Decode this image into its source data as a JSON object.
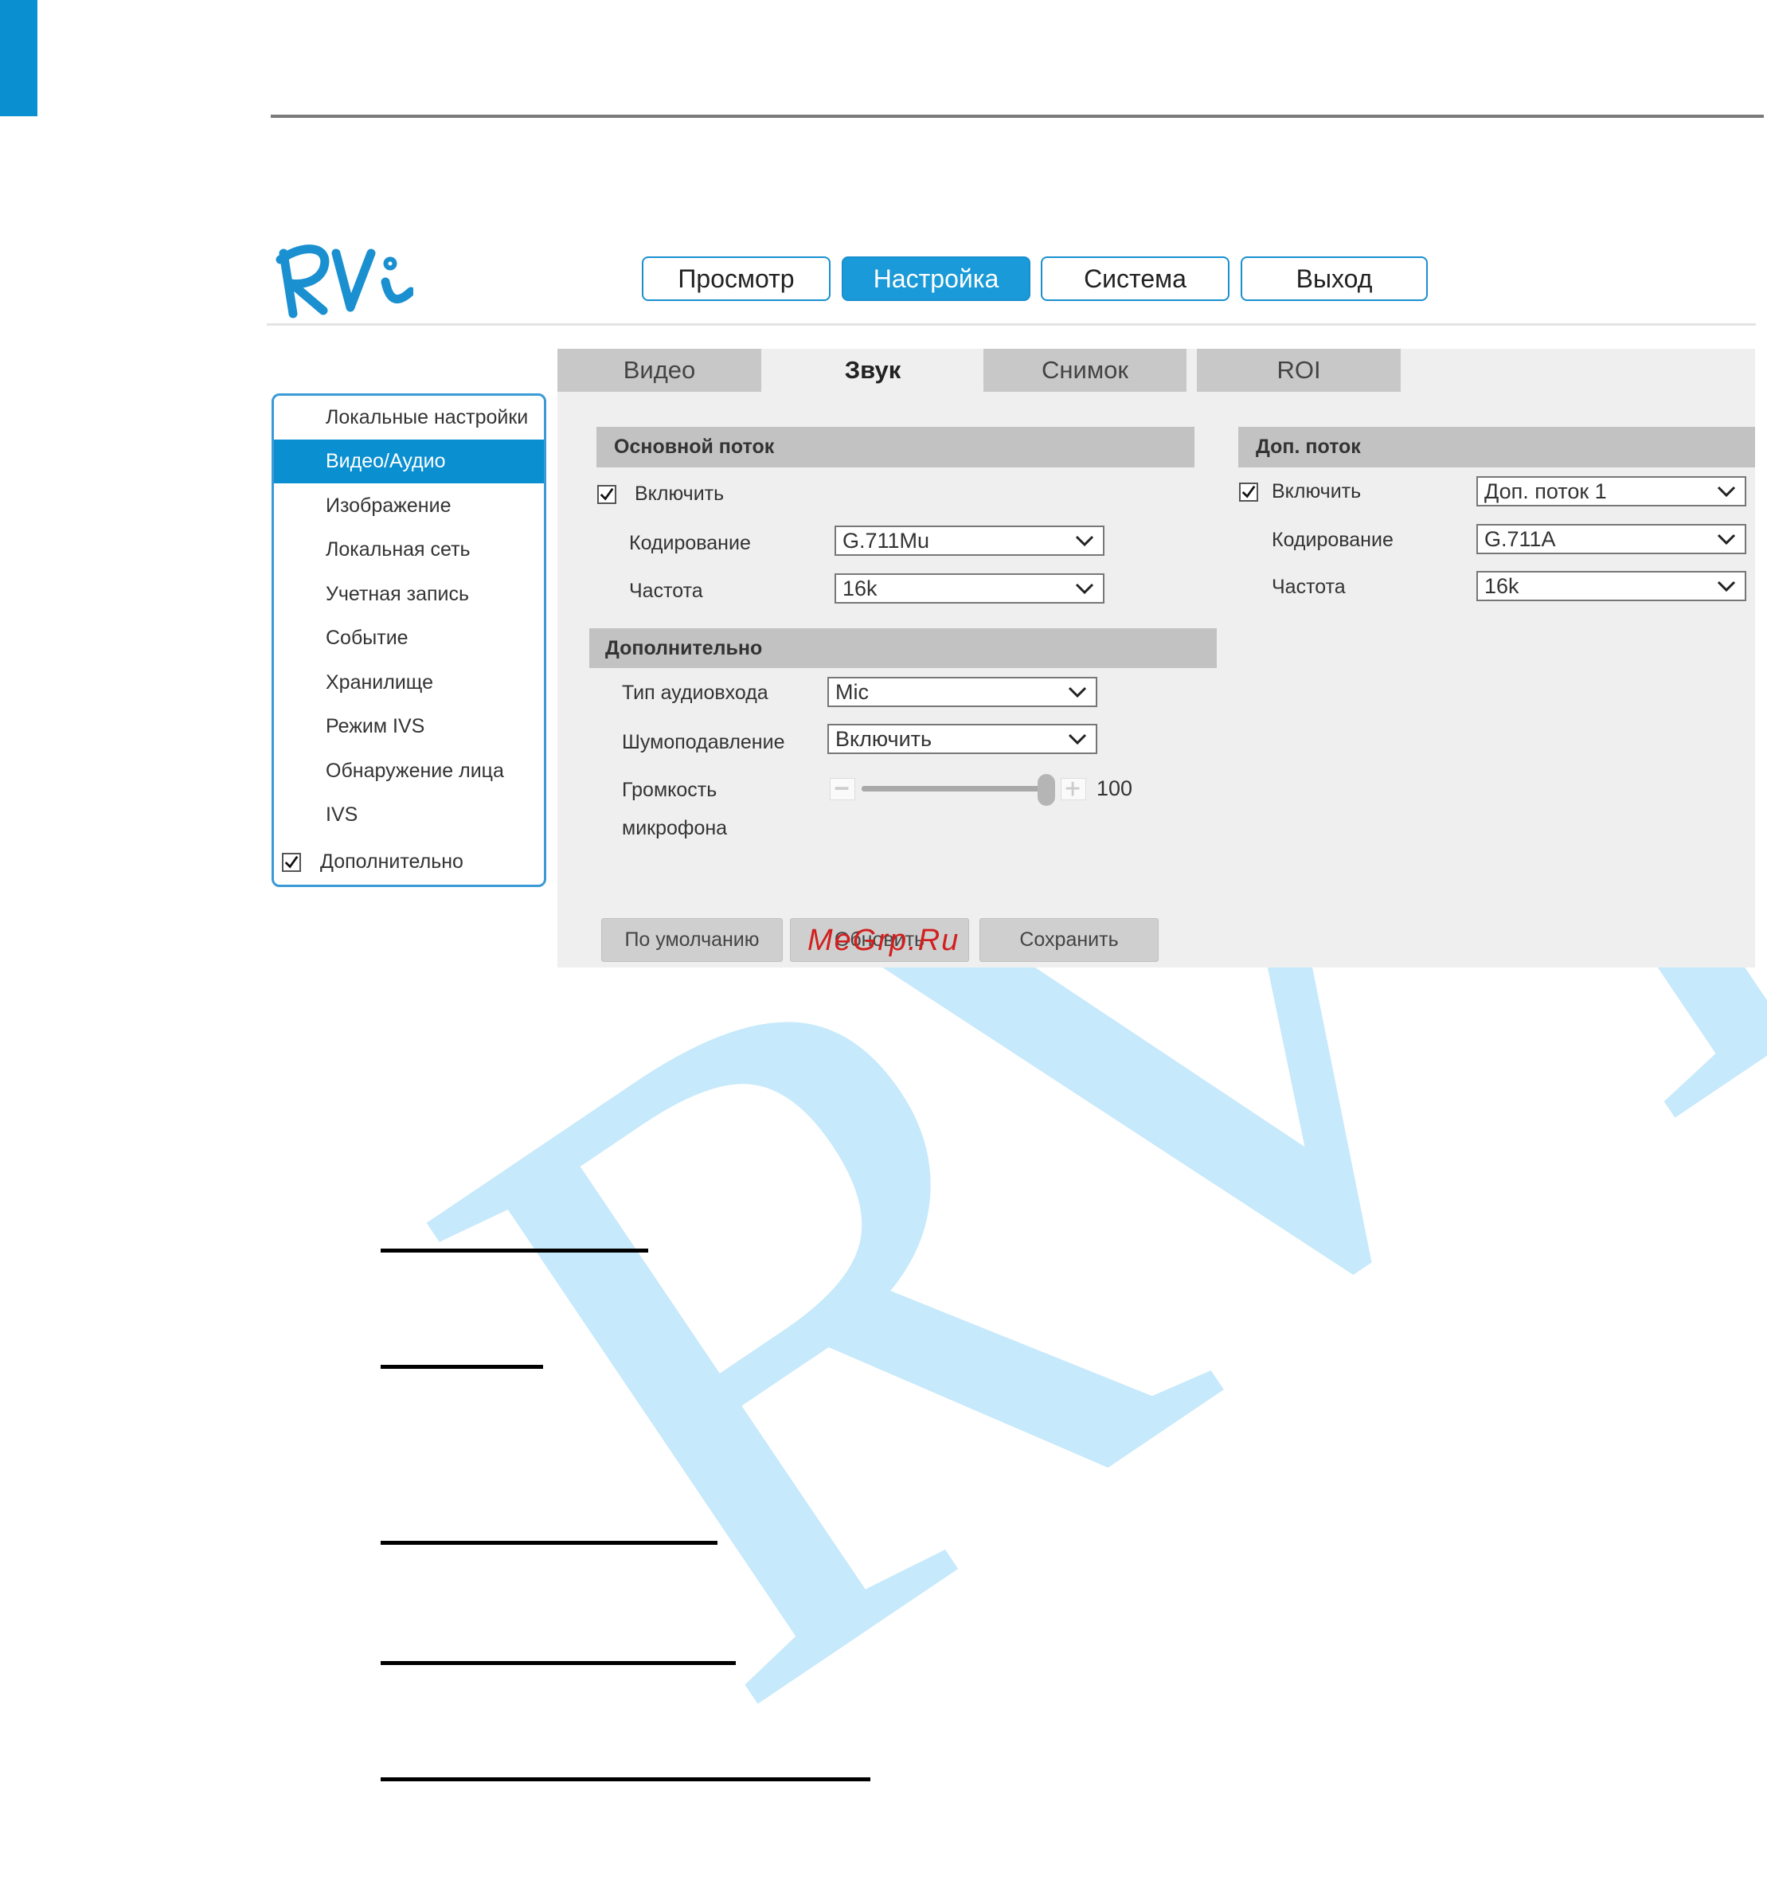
{
  "document": {
    "watermark_letters": [
      "R",
      "V",
      "i"
    ],
    "site_watermark": "MeGrp.Ru"
  },
  "app": {
    "logo_text": "RVi",
    "brand_color": "#0a8fd1"
  },
  "header": {
    "buttons": [
      {
        "label": "Просмотр",
        "active": false
      },
      {
        "label": "Настройка",
        "active": true
      },
      {
        "label": "Система",
        "active": false
      },
      {
        "label": "Выход",
        "active": false
      }
    ]
  },
  "sidebar": {
    "items": [
      {
        "label": "Локальные настройки",
        "active": false
      },
      {
        "label": "Видео/Аудио",
        "active": true
      },
      {
        "label": "Изображение",
        "active": false
      },
      {
        "label": "Локальная сеть",
        "active": false
      },
      {
        "label": "Учетная запись",
        "active": false
      },
      {
        "label": "Событие",
        "active": false
      },
      {
        "label": "Хранилище",
        "active": false
      },
      {
        "label": "Режим IVS",
        "active": false
      },
      {
        "label": "Обнаружение лица",
        "active": false
      },
      {
        "label": "IVS",
        "active": false
      },
      {
        "label": "Дополнительно",
        "active": false,
        "checked": true
      }
    ]
  },
  "tabs": [
    {
      "label": "Видео",
      "active": false
    },
    {
      "label": "Звук",
      "active": true
    },
    {
      "label": "Снимок",
      "active": false
    },
    {
      "label": "ROI",
      "active": false
    }
  ],
  "main_stream": {
    "title": "Основной поток",
    "enable_label": "Включить",
    "enabled": true,
    "encoding_label": "Кодирование",
    "encoding_value": "G.711Mu",
    "frequency_label": "Частота",
    "frequency_value": "16k"
  },
  "sub_stream": {
    "title": "Доп. поток",
    "enable_label": "Включить",
    "enabled": true,
    "stream_value": "Доп. поток 1",
    "encoding_label": "Кодирование",
    "encoding_value": "G.711A",
    "frequency_label": "Частота",
    "frequency_value": "16k"
  },
  "additional": {
    "title": "Дополнительно",
    "input_type_label": "Тип аудиовхода",
    "input_type_value": "Mic",
    "noise_label": "Шумоподавление",
    "noise_value": "Включить",
    "volume_label_line1": "Громкость",
    "volume_label_line2": "микрофона",
    "volume_value": "100",
    "volume_fraction": 1.0
  },
  "actions": {
    "default_label": "По умолчанию",
    "refresh_label": "Обновить",
    "save_label": "Сохранить"
  }
}
